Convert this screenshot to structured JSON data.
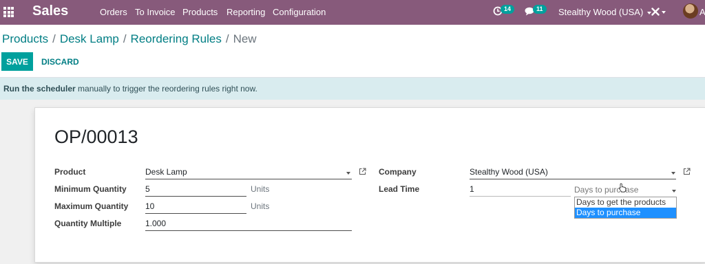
{
  "app": {
    "name": "Sales"
  },
  "menu": [
    "Orders",
    "To Invoice",
    "Products",
    "Reporting",
    "Configuration"
  ],
  "systray": {
    "activity_count": "14",
    "message_count": "11",
    "company": "Stealthy Wood (USA)",
    "user_initial": "A"
  },
  "breadcrumb": {
    "items": [
      "Products",
      "Desk Lamp",
      "Reordering Rules"
    ],
    "current": "New"
  },
  "buttons": {
    "save": "SAVE",
    "discard": "DISCARD"
  },
  "alert": {
    "link": "Run the scheduler",
    "text": " manually to trigger the reordering rules right now."
  },
  "form": {
    "name": "OP/00013",
    "labels": {
      "product": "Product",
      "min_qty": "Minimum Quantity",
      "max_qty": "Maximum Quantity",
      "qty_multiple": "Quantity Multiple",
      "company": "Company",
      "lead_time": "Lead Time"
    },
    "values": {
      "product": "Desk Lamp",
      "min_qty": "5",
      "max_qty": "10",
      "qty_multiple": "1.000",
      "company": "Stealthy Wood (USA)",
      "lead_time": "1"
    },
    "units": {
      "min_qty": "Units",
      "max_qty": "Units"
    },
    "lead_type": {
      "selected": "Days to purchase",
      "options": [
        "Days to get the products",
        "Days to purchase"
      ],
      "highlighted_index": 1
    }
  }
}
